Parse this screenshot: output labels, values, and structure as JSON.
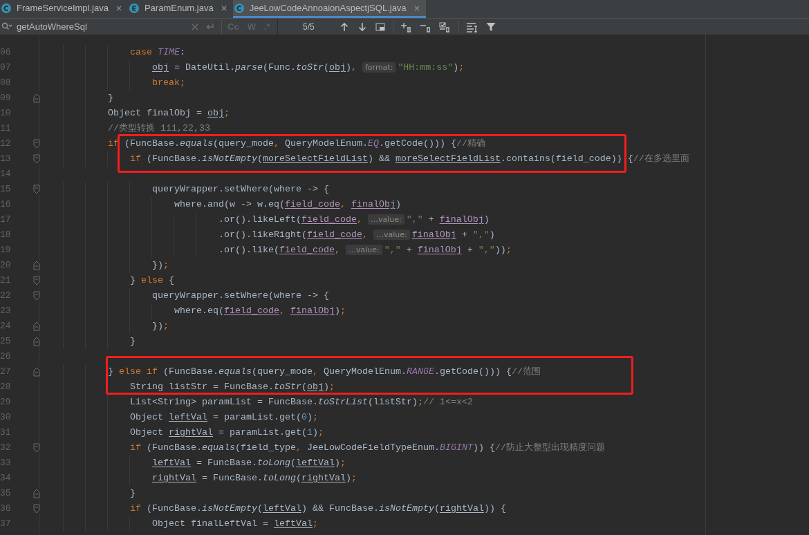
{
  "tabs": [
    {
      "label": "FrameServiceImpl.java",
      "kind": "class",
      "selected": false
    },
    {
      "label": "ParamEnum.java",
      "kind": "enum",
      "selected": false
    },
    {
      "label": "JeeLowCodeAnnoaionAspectjSQL.java",
      "kind": "class",
      "selected": true
    }
  ],
  "search": {
    "value": "getAutoWhereSql",
    "options": [
      "Cc",
      "W",
      ".*"
    ],
    "count": "5/5"
  },
  "lines": [
    {
      "number": "06",
      "tokens": [
        {
          "kind": "k",
          "text": "                case "
        },
        {
          "kind": "c",
          "text": "TIME"
        },
        {
          "kind": "p",
          "text": ":"
        }
      ]
    },
    {
      "number": "07",
      "tokens": [
        {
          "kind": "u",
          "text": "                    obj"
        },
        {
          "kind": "p",
          "text": " = DateUtil."
        },
        {
          "kind": "i",
          "text": "parse"
        },
        {
          "kind": "p",
          "text": "(Func."
        },
        {
          "kind": "i",
          "text": "toStr"
        },
        {
          "kind": "p",
          "text": "("
        },
        {
          "kind": "u",
          "text": "obj"
        },
        {
          "kind": "p",
          "text": ")"
        },
        {
          "kind": "o",
          "text": ", "
        },
        {
          "kind": "h",
          "text": "format:"
        },
        {
          "kind": "s",
          "text": "\"HH:mm:ss\""
        },
        {
          "kind": "p",
          "text": ")"
        },
        {
          "kind": "o",
          "text": ";"
        }
      ]
    },
    {
      "number": "08",
      "tokens": [
        {
          "kind": "k",
          "text": "                    break;"
        }
      ]
    },
    {
      "number": "09",
      "fold": {
        "kind": "end"
      },
      "tokens": [
        {
          "kind": "p",
          "text": "            }"
        }
      ]
    },
    {
      "number": "10",
      "tokens": [
        {
          "kind": "p",
          "text": "            Object finalObj = "
        },
        {
          "kind": "u",
          "text": "obj"
        },
        {
          "kind": "o",
          "text": ";"
        }
      ]
    },
    {
      "number": "11",
      "tokens": [
        {
          "kind": "m",
          "text": "            //类型转换 111,22,33"
        }
      ]
    },
    {
      "number": "12",
      "fold": {
        "kind": "start"
      },
      "tokens": [
        {
          "kind": "k",
          "text": "            if"
        },
        {
          "kind": "p",
          "text": " (FuncBase."
        },
        {
          "kind": "i",
          "text": "equals"
        },
        {
          "kind": "p",
          "text": "(query_mode"
        },
        {
          "kind": "o",
          "text": ","
        },
        {
          "kind": "p",
          "text": " QueryModelEnum."
        },
        {
          "kind": "c",
          "text": "EQ"
        },
        {
          "kind": "p",
          "text": ".getCode())) {"
        },
        {
          "kind": "m",
          "text": "//精确"
        }
      ]
    },
    {
      "number": "13",
      "fold": {
        "kind": "start"
      },
      "tokens": [
        {
          "kind": "k",
          "text": "                if"
        },
        {
          "kind": "p",
          "text": " (FuncBase."
        },
        {
          "kind": "i",
          "text": "isNotEmpty"
        },
        {
          "kind": "p",
          "text": "("
        },
        {
          "kind": "u",
          "text": "moreSelectFieldList"
        },
        {
          "kind": "p",
          "text": ") && "
        },
        {
          "kind": "u",
          "text": "moreSelectFieldList"
        },
        {
          "kind": "p",
          "text": ".contains(field_code)) {"
        },
        {
          "kind": "m",
          "text": "//在多选里面"
        }
      ]
    },
    {
      "number": "14"
    },
    {
      "number": "15",
      "fold": {
        "kind": "start"
      },
      "tokens": [
        {
          "kind": "p",
          "text": "                    queryWrapper.setWhere(where -> {"
        }
      ]
    },
    {
      "number": "16",
      "tokens": [
        {
          "kind": "p",
          "text": "                        where.and(w -> w.eq("
        },
        {
          "kind": "v",
          "text": "field_code"
        },
        {
          "kind": "o",
          "text": ", "
        },
        {
          "kind": "v",
          "text": "finalObj"
        },
        {
          "kind": "p",
          "text": ")"
        }
      ]
    },
    {
      "number": "17",
      "tokens": [
        {
          "kind": "p",
          "text": "                                .or().likeLeft("
        },
        {
          "kind": "v",
          "text": "field_code"
        },
        {
          "kind": "o",
          "text": ", "
        },
        {
          "kind": "h",
          "text": "…value:"
        },
        {
          "kind": "s",
          "text": "\",\""
        },
        {
          "kind": "p",
          "text": " + "
        },
        {
          "kind": "v",
          "text": "finalObj"
        },
        {
          "kind": "p",
          "text": ")"
        }
      ]
    },
    {
      "number": "18",
      "tokens": [
        {
          "kind": "p",
          "text": "                                .or().likeRight("
        },
        {
          "kind": "v",
          "text": "field_code"
        },
        {
          "kind": "o",
          "text": ", "
        },
        {
          "kind": "h",
          "text": "…value:"
        },
        {
          "kind": "v",
          "text": "finalObj"
        },
        {
          "kind": "p",
          "text": " + "
        },
        {
          "kind": "s",
          "text": "\",\""
        },
        {
          "kind": "p",
          "text": ")"
        }
      ]
    },
    {
      "number": "19",
      "tokens": [
        {
          "kind": "p",
          "text": "                                .or().like("
        },
        {
          "kind": "v",
          "text": "field_code"
        },
        {
          "kind": "o",
          "text": ", "
        },
        {
          "kind": "h",
          "text": "…value:"
        },
        {
          "kind": "s",
          "text": "\",\""
        },
        {
          "kind": "p",
          "text": " + "
        },
        {
          "kind": "v",
          "text": "finalObj"
        },
        {
          "kind": "p",
          "text": " + "
        },
        {
          "kind": "s",
          "text": "\",\""
        },
        {
          "kind": "p",
          "text": "))"
        },
        {
          "kind": "o",
          "text": ";"
        }
      ]
    },
    {
      "number": "20",
      "fold": {
        "kind": "end"
      },
      "tokens": [
        {
          "kind": "p",
          "text": "                    })"
        },
        {
          "kind": "o",
          "text": ";"
        }
      ]
    },
    {
      "number": "21",
      "fold": {
        "kind": "start"
      },
      "tokens": [
        {
          "kind": "p",
          "text": "                } "
        },
        {
          "kind": "k",
          "text": "else"
        },
        {
          "kind": "p",
          "text": " {"
        }
      ]
    },
    {
      "number": "22",
      "fold": {
        "kind": "start"
      },
      "tokens": [
        {
          "kind": "p",
          "text": "                    queryWrapper.setWhere(where -> {"
        }
      ]
    },
    {
      "number": "23",
      "tokens": [
        {
          "kind": "p",
          "text": "                        where.eq("
        },
        {
          "kind": "v",
          "text": "field_code"
        },
        {
          "kind": "o",
          "text": ", "
        },
        {
          "kind": "v",
          "text": "finalObj"
        },
        {
          "kind": "p",
          "text": ")"
        },
        {
          "kind": "o",
          "text": ";"
        }
      ]
    },
    {
      "number": "24",
      "fold": {
        "kind": "end"
      },
      "tokens": [
        {
          "kind": "p",
          "text": "                    })"
        },
        {
          "kind": "o",
          "text": ";"
        }
      ]
    },
    {
      "number": "25",
      "fold": {
        "kind": "end"
      },
      "tokens": [
        {
          "kind": "p",
          "text": "                }"
        }
      ]
    },
    {
      "number": "26"
    },
    {
      "number": "27",
      "fold": {
        "kind": "end"
      },
      "tokens": [
        {
          "kind": "p",
          "text": "            } "
        },
        {
          "kind": "k",
          "text": "else if"
        },
        {
          "kind": "p",
          "text": " (FuncBase."
        },
        {
          "kind": "i",
          "text": "equals"
        },
        {
          "kind": "p",
          "text": "(query_mode"
        },
        {
          "kind": "o",
          "text": ","
        },
        {
          "kind": "p",
          "text": " QueryModelEnum."
        },
        {
          "kind": "c",
          "text": "RANGE"
        },
        {
          "kind": "p",
          "text": ".getCode())) {"
        },
        {
          "kind": "m",
          "text": "//范围"
        }
      ]
    },
    {
      "number": "28",
      "tokens": [
        {
          "kind": "p",
          "text": "                String listStr = FuncBase."
        },
        {
          "kind": "i",
          "text": "toStr"
        },
        {
          "kind": "p",
          "text": "("
        },
        {
          "kind": "u",
          "text": "obj"
        },
        {
          "kind": "p",
          "text": ")"
        },
        {
          "kind": "o",
          "text": ";"
        }
      ]
    },
    {
      "number": "29",
      "tokens": [
        {
          "kind": "p",
          "text": "                List<String> paramList = FuncBase."
        },
        {
          "kind": "i",
          "text": "toStrList"
        },
        {
          "kind": "p",
          "text": "(listStr)"
        },
        {
          "kind": "o",
          "text": ";"
        },
        {
          "kind": "m",
          "text": "// 1<=x<2"
        }
      ]
    },
    {
      "number": "30",
      "tokens": [
        {
          "kind": "p",
          "text": "                Object "
        },
        {
          "kind": "u",
          "text": "leftVal"
        },
        {
          "kind": "p",
          "text": " = paramList.get("
        },
        {
          "kind": "n",
          "text": "0"
        },
        {
          "kind": "p",
          "text": ")"
        },
        {
          "kind": "o",
          "text": ";"
        }
      ]
    },
    {
      "number": "31",
      "tokens": [
        {
          "kind": "p",
          "text": "                Object "
        },
        {
          "kind": "u",
          "text": "rightVal"
        },
        {
          "kind": "p",
          "text": " = paramList.get("
        },
        {
          "kind": "n",
          "text": "1"
        },
        {
          "kind": "p",
          "text": ")"
        },
        {
          "kind": "o",
          "text": ";"
        }
      ]
    },
    {
      "number": "32",
      "fold": {
        "kind": "start"
      },
      "tokens": [
        {
          "kind": "k",
          "text": "                if"
        },
        {
          "kind": "p",
          "text": " (FuncBase."
        },
        {
          "kind": "i",
          "text": "equals"
        },
        {
          "kind": "p",
          "text": "(field_type"
        },
        {
          "kind": "o",
          "text": ","
        },
        {
          "kind": "p",
          "text": " JeeLowCodeFieldTypeEnum."
        },
        {
          "kind": "c",
          "text": "BIGINT"
        },
        {
          "kind": "p",
          "text": ")) {"
        },
        {
          "kind": "m",
          "text": "//防止大整型出现精度问题"
        }
      ]
    },
    {
      "number": "33",
      "tokens": [
        {
          "kind": "u",
          "text": "                    leftVal"
        },
        {
          "kind": "p",
          "text": " = FuncBase."
        },
        {
          "kind": "i",
          "text": "toLong"
        },
        {
          "kind": "p",
          "text": "("
        },
        {
          "kind": "u",
          "text": "leftVal"
        },
        {
          "kind": "p",
          "text": ")"
        },
        {
          "kind": "o",
          "text": ";"
        }
      ]
    },
    {
      "number": "34",
      "tokens": [
        {
          "kind": "u",
          "text": "                    rightVal"
        },
        {
          "kind": "p",
          "text": " = FuncBase."
        },
        {
          "kind": "i",
          "text": "toLong"
        },
        {
          "kind": "p",
          "text": "("
        },
        {
          "kind": "u",
          "text": "rightVal"
        },
        {
          "kind": "p",
          "text": ")"
        },
        {
          "kind": "o",
          "text": ";"
        }
      ]
    },
    {
      "number": "35",
      "fold": {
        "kind": "end"
      },
      "tokens": [
        {
          "kind": "p",
          "text": "                }"
        }
      ]
    },
    {
      "number": "36",
      "fold": {
        "kind": "start"
      },
      "tokens": [
        {
          "kind": "k",
          "text": "                if"
        },
        {
          "kind": "p",
          "text": " (FuncBase."
        },
        {
          "kind": "i",
          "text": "isNotEmpty"
        },
        {
          "kind": "p",
          "text": "("
        },
        {
          "kind": "u",
          "text": "leftVal"
        },
        {
          "kind": "p",
          "text": ") && FuncBase."
        },
        {
          "kind": "i",
          "text": "isNotEmpty"
        },
        {
          "kind": "p",
          "text": "("
        },
        {
          "kind": "u",
          "text": "rightVal"
        },
        {
          "kind": "p",
          "text": ")) {"
        }
      ]
    },
    {
      "number": "37",
      "tokens": [
        {
          "kind": "p",
          "text": "                    Object finalLeftVal = "
        },
        {
          "kind": "u",
          "text": "leftVal"
        },
        {
          "kind": "o",
          "text": ";"
        }
      ]
    }
  ]
}
